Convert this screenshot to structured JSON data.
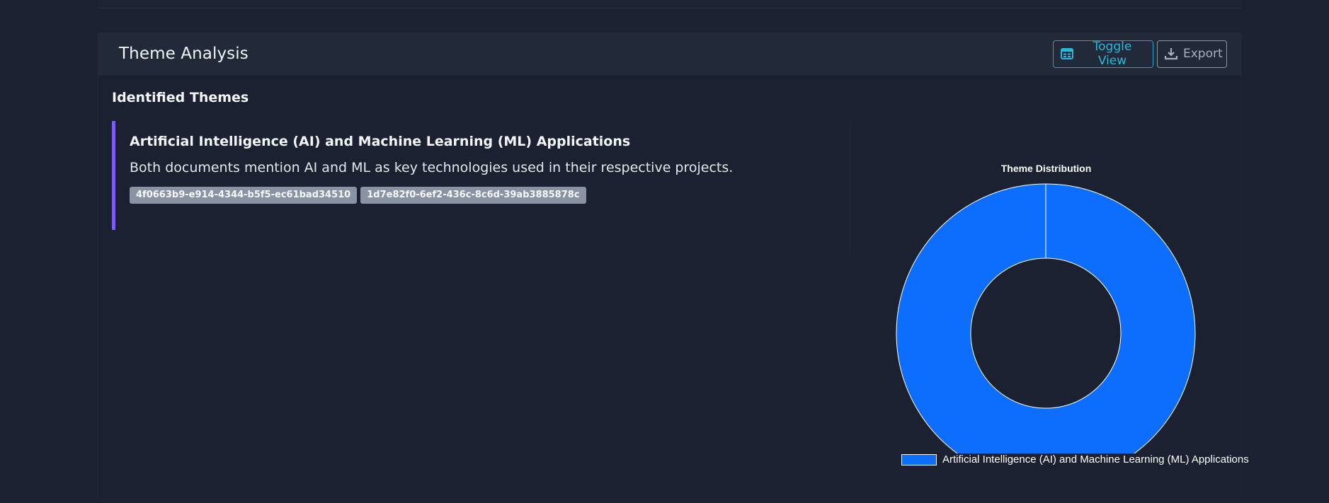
{
  "card": {
    "title": "Theme Analysis",
    "toggle_label": "Toggle View",
    "export_label": "Export"
  },
  "section": {
    "heading": "Identified Themes"
  },
  "themes": [
    {
      "title": "Artificial Intelligence (AI) and Machine Learning (ML) Applications",
      "description": "Both documents mention AI and ML as key technologies used in their respective projects.",
      "document_tags": [
        "4f0663b9-e914-4344-b5f5-ec61bad34510",
        "1d7e82f0-6ef2-436c-8c6d-39ab3885878c"
      ]
    }
  ],
  "colors": {
    "accent": "#7b5cf0",
    "toggle": "#2ab8dc",
    "slice": "#0d6efd",
    "background": "#1c2231"
  },
  "icons": {
    "toggle": "table-icon",
    "export": "download-icon"
  },
  "chart_data": {
    "type": "pie",
    "variant": "doughnut",
    "title": "Theme Distribution",
    "categories": [
      "Artificial Intelligence (AI) and Machine Learning (ML) Applications"
    ],
    "values": [
      1
    ],
    "colors": [
      "#0d6efd"
    ],
    "legend": "bottom"
  }
}
